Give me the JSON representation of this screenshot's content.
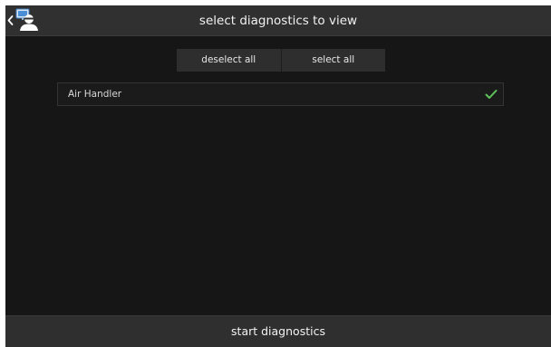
{
  "header": {
    "title": "select diagnostics to view",
    "back_icon": "chevron-left-icon",
    "avatar_icon": "technician-monitor-icon"
  },
  "selection": {
    "deselect_all_label": "deselect all",
    "select_all_label": "select all"
  },
  "diagnostics": [
    {
      "label": "Air Handler",
      "selected": true,
      "check_icon": "checkmark-icon"
    }
  ],
  "footer": {
    "start_label": "start diagnostics"
  },
  "colors": {
    "background": "#161616",
    "bar": "#303030",
    "check": "#5fc35b"
  }
}
